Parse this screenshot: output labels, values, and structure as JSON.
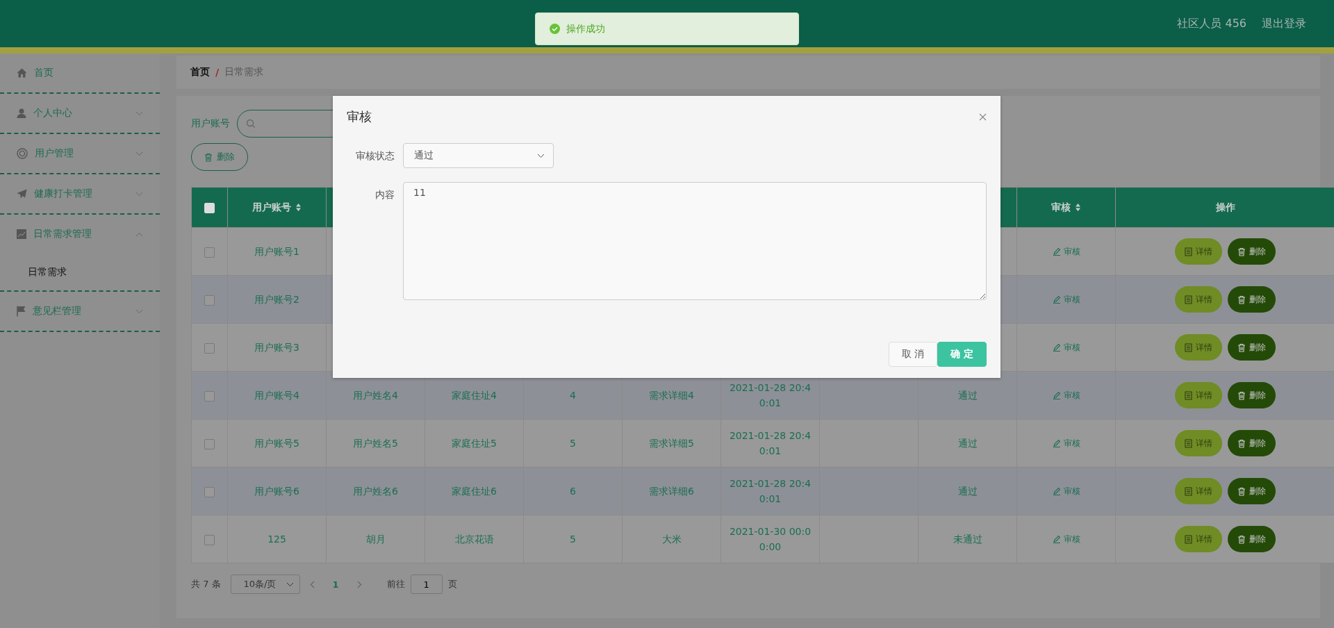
{
  "header": {
    "user": "社区人员 456",
    "logout": "退出登录"
  },
  "toast": {
    "text": "操作成功"
  },
  "sidebar": {
    "items": [
      {
        "label": "首页"
      },
      {
        "label": "个人中心",
        "expanded": false
      },
      {
        "label": "用户管理",
        "expanded": false
      },
      {
        "label": "健康打卡管理",
        "expanded": false
      },
      {
        "label": "日常需求管理",
        "expanded": true,
        "children": [
          {
            "label": "日常需求",
            "selected": true
          }
        ]
      },
      {
        "label": "意见栏管理",
        "expanded": false
      }
    ]
  },
  "breadcrumb": {
    "items": [
      "首页",
      "日常需求"
    ],
    "separator": "/"
  },
  "search": {
    "label": "用户账号"
  },
  "delete_button": "删除",
  "table": {
    "select_all": {
      "checked": false
    },
    "columns": [
      {
        "label": "用户账号",
        "sortable": true
      },
      {
        "label": "审核",
        "sortable": true
      },
      {
        "label": "操作",
        "sortable": false
      }
    ],
    "rows": [
      {
        "checked": false,
        "account": "用户账号1",
        "review": "审核",
        "detail": "详情",
        "delete": "删除"
      },
      {
        "checked": false,
        "account": "用户账号2",
        "review": "审核",
        "detail": "详情",
        "delete": "删除"
      },
      {
        "checked": false,
        "account": "用户账号3",
        "review": "审核",
        "detail": "详情",
        "delete": "删除"
      },
      {
        "checked": false,
        "account": "用户账号4",
        "name": "用户姓名4",
        "address": "家庭住址4",
        "members": "4",
        "need": "需求详细4",
        "time": "2021-01-28 20:40:01",
        "status": "通过",
        "review": "审核",
        "detail": "详情",
        "delete": "删除"
      },
      {
        "checked": false,
        "account": "用户账号5",
        "name": "用户姓名5",
        "address": "家庭住址5",
        "members": "5",
        "need": "需求详细5",
        "time": "2021-01-28 20:40:01",
        "status": "通过",
        "review": "审核",
        "detail": "详情",
        "delete": "删除"
      },
      {
        "checked": false,
        "account": "用户账号6",
        "name": "用户姓名6",
        "address": "家庭住址6",
        "members": "6",
        "need": "需求详细6",
        "time": "2021-01-28 20:40:01",
        "status": "通过",
        "review": "审核",
        "detail": "详情",
        "delete": "删除"
      },
      {
        "checked": false,
        "account": "125",
        "name": "胡月",
        "address": "北京花语",
        "members": "5",
        "need": "大米",
        "time": "2021-01-30 00:00:00",
        "status": "未通过",
        "review": "审核",
        "detail": "详情",
        "delete": "删除"
      }
    ]
  },
  "pagination": {
    "total": "共 7 条",
    "page_size": "10条/页",
    "pages": [
      {
        "label": "1",
        "selected": true
      }
    ],
    "goto_label": "前往",
    "goto_value": "1",
    "goto_suffix": "页"
  },
  "dialog": {
    "title": "审核",
    "fields": [
      {
        "kind": "select",
        "label": "审核状态",
        "value": "通过"
      },
      {
        "kind": "textarea",
        "label": "内容",
        "value": "11"
      }
    ],
    "buttons": [
      {
        "kind": "default",
        "label": "取 消"
      },
      {
        "kind": "primary",
        "label": "确 定"
      }
    ]
  }
}
